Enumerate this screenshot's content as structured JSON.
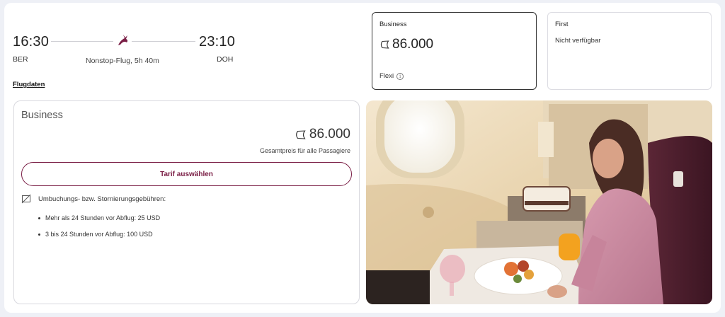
{
  "flight": {
    "departure_time": "16:30",
    "departure_code": "BER",
    "arrival_time": "23:10",
    "arrival_code": "DOH",
    "duration": "Nonstop-Flug, 5h 40m",
    "details_link": "Flugdaten"
  },
  "fares": {
    "business": {
      "title": "Business",
      "price": "86.000",
      "flexi": "Flexi"
    },
    "first": {
      "title": "First",
      "status": "Nicht verfügbar"
    }
  },
  "detail": {
    "cabin": "Business",
    "price": "86.000",
    "total_label": "Gesamtpreis für alle Passagiere",
    "select_button": "Tarif auswählen",
    "fees_title": "Umbuchungs- bzw. Stornierungsgebühren:",
    "fees": [
      "Mehr als 24 Stunden vor Abflug: 25 USD",
      "3 bis 24 Stunden vor Abflug: 100 USD"
    ]
  },
  "colors": {
    "brand": "#7a1e45",
    "background": "#eef0f6"
  },
  "icons": {
    "airline": "oryx-logo-icon",
    "points": "avios-icon",
    "info": "info-icon",
    "fees": "no-change-icon"
  }
}
